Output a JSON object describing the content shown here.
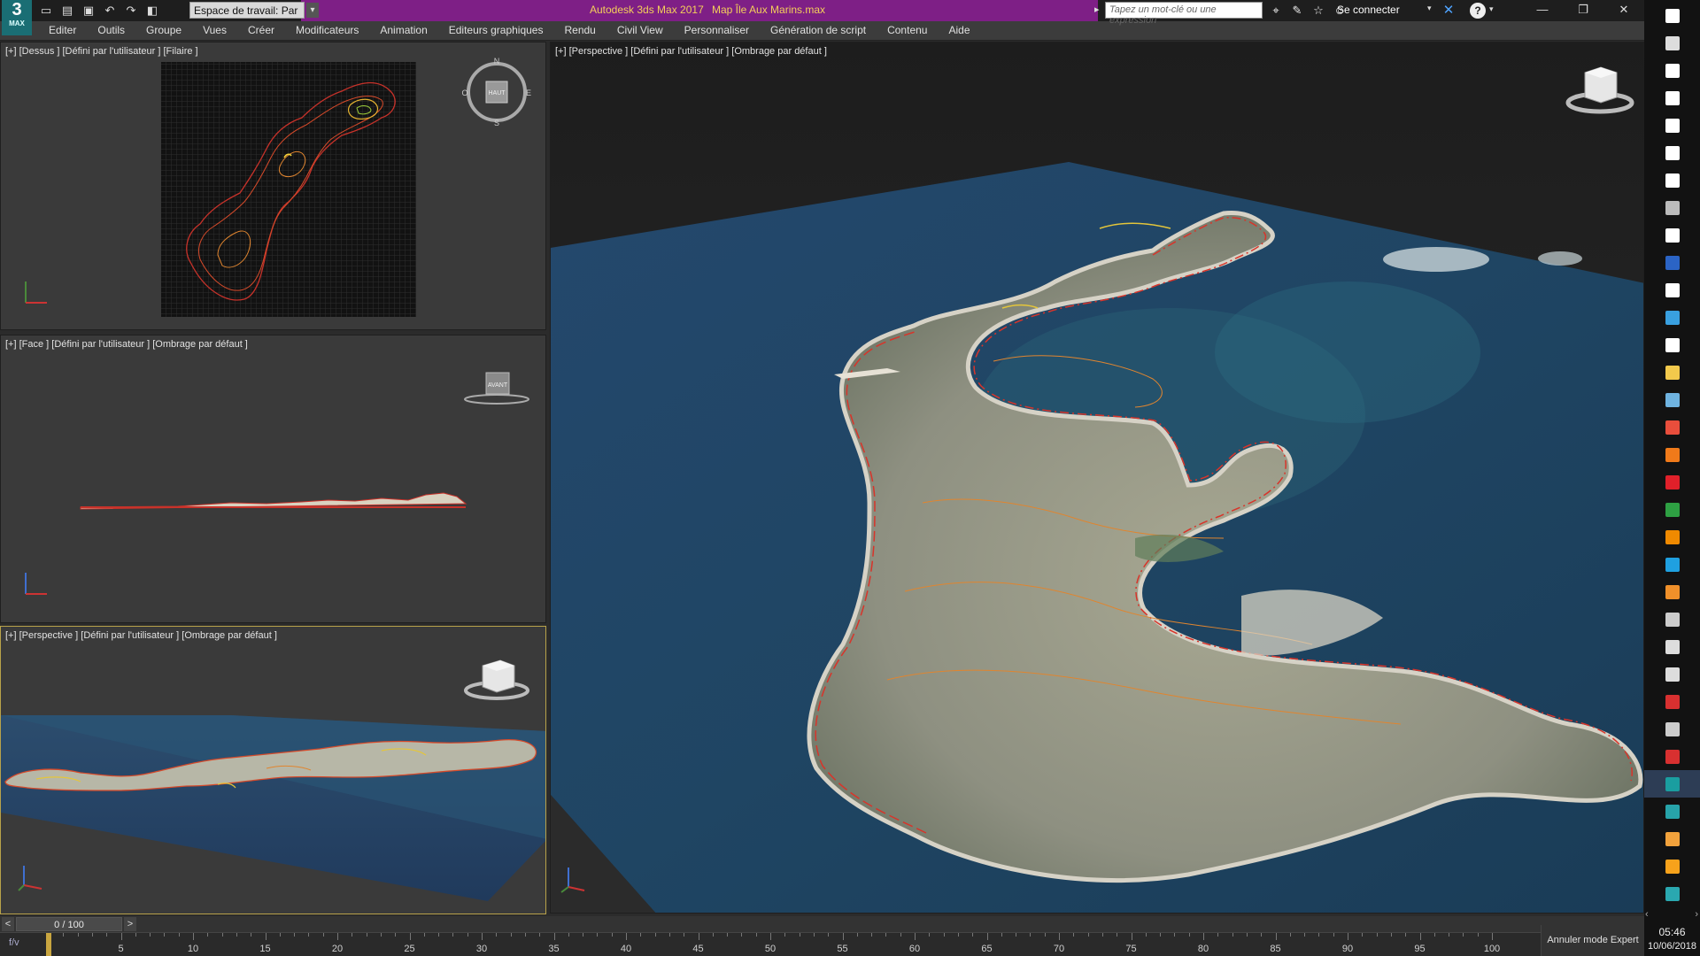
{
  "app": {
    "logo_big": "3",
    "logo_small": "MAX",
    "title": "Autodesk 3ds Max 2017",
    "file": "Map Île Aux Marins.max",
    "workspace_label": "Espace de travail: Par",
    "search_placeholder": "Tapez un mot-clé ou une expression",
    "signin_label": "Se connecter"
  },
  "quick_access": [
    "new-file-icon",
    "open-file-icon",
    "save-icon",
    "undo-icon",
    "redo-icon",
    "project-icon"
  ],
  "menu": [
    "Editer",
    "Outils",
    "Groupe",
    "Vues",
    "Créer",
    "Modificateurs",
    "Animation",
    "Editeurs graphiques",
    "Rendu",
    "Civil View",
    "Personnaliser",
    "Génération de script",
    "Contenu",
    "Aide"
  ],
  "viewports": {
    "top": {
      "label": "[+] [Dessus ] [Défini par l'utilisateur ] [Filaire ]",
      "nav_label": "HAUT"
    },
    "front": {
      "label": "[+] [Face ] [Défini par l'utilisateur ] [Ombrage par défaut ]",
      "nav_label": "AVANT"
    },
    "persp_small": {
      "label": "[+] [Perspective ] [Défini par l'utilisateur ] [Ombrage par défaut ]"
    },
    "persp_big": {
      "label": "[+] [Perspective ] [Défini par l'utilisateur ] [Ombrage par défaut ]"
    }
  },
  "compass": {
    "n": "N",
    "s": "S",
    "e": "E",
    "o": "O"
  },
  "timeline": {
    "slider_label": "0 / 100",
    "current_frame": 0,
    "max_frame": 100,
    "ticks": [
      0,
      5,
      10,
      15,
      20,
      25,
      30,
      35,
      40,
      45,
      50,
      55,
      60,
      65,
      70,
      75,
      80,
      85,
      90,
      95,
      100
    ]
  },
  "expert_mode_label": "Annuler mode Expert",
  "taskbar": {
    "clock": "05:46",
    "date": "10/06/2018",
    "apps": [
      {
        "name": "start-icon",
        "color": "#ffffff"
      },
      {
        "name": "task-view-icon",
        "color": "#dddddd"
      },
      {
        "name": "store-icon",
        "color": "#ffffff"
      },
      {
        "name": "mail-icon",
        "color": "#ffffff"
      },
      {
        "name": "settings-icon",
        "color": "#ffffff"
      },
      {
        "name": "media-icon",
        "color": "#ffffff"
      },
      {
        "name": "note-icon",
        "color": "#ffffff"
      },
      {
        "name": "edge-icon",
        "color": "#bbbbbb"
      },
      {
        "name": "calculator-icon",
        "color": "#ffffff"
      },
      {
        "name": "word-icon",
        "color": "#2b64c5"
      },
      {
        "name": "world-icon",
        "color": "#ffffff"
      },
      {
        "name": "photos-icon",
        "color": "#39a0e0"
      },
      {
        "name": "notebook-icon",
        "color": "#ffffff"
      },
      {
        "name": "folder-icon",
        "color": "#f2c94c"
      },
      {
        "name": "gallery-icon",
        "color": "#6fb3e0"
      },
      {
        "name": "chrome-icon",
        "color": "#e94e3c"
      },
      {
        "name": "firefox-icon",
        "color": "#f07a1a"
      },
      {
        "name": "opera-icon",
        "color": "#e0202a"
      },
      {
        "name": "green-app-icon",
        "color": "#2ea043"
      },
      {
        "name": "vlc-icon",
        "color": "#f08a00"
      },
      {
        "name": "skype-icon",
        "color": "#1fa0e0"
      },
      {
        "name": "blender-icon",
        "color": "#f0902a"
      },
      {
        "name": "eye-icon",
        "color": "#cccccc"
      },
      {
        "name": "inkscape-icon",
        "color": "#dddddd"
      },
      {
        "name": "speaker-icon",
        "color": "#dddddd"
      },
      {
        "name": "lifesaver-icon",
        "color": "#d83030"
      },
      {
        "name": "zbrush-icon",
        "color": "#cccccc"
      },
      {
        "name": "red-app-icon",
        "color": "#d83030"
      },
      {
        "name": "3dsmax-icon",
        "color": "#1a9ea0"
      },
      {
        "name": "maya-icon",
        "color": "#27a3a9"
      },
      {
        "name": "fusion-icon",
        "color": "#f2a23c"
      },
      {
        "name": "illustrator-icon",
        "color": "#f7a21b"
      },
      {
        "name": "mudbox-icon",
        "color": "#2aa8b0"
      }
    ]
  }
}
